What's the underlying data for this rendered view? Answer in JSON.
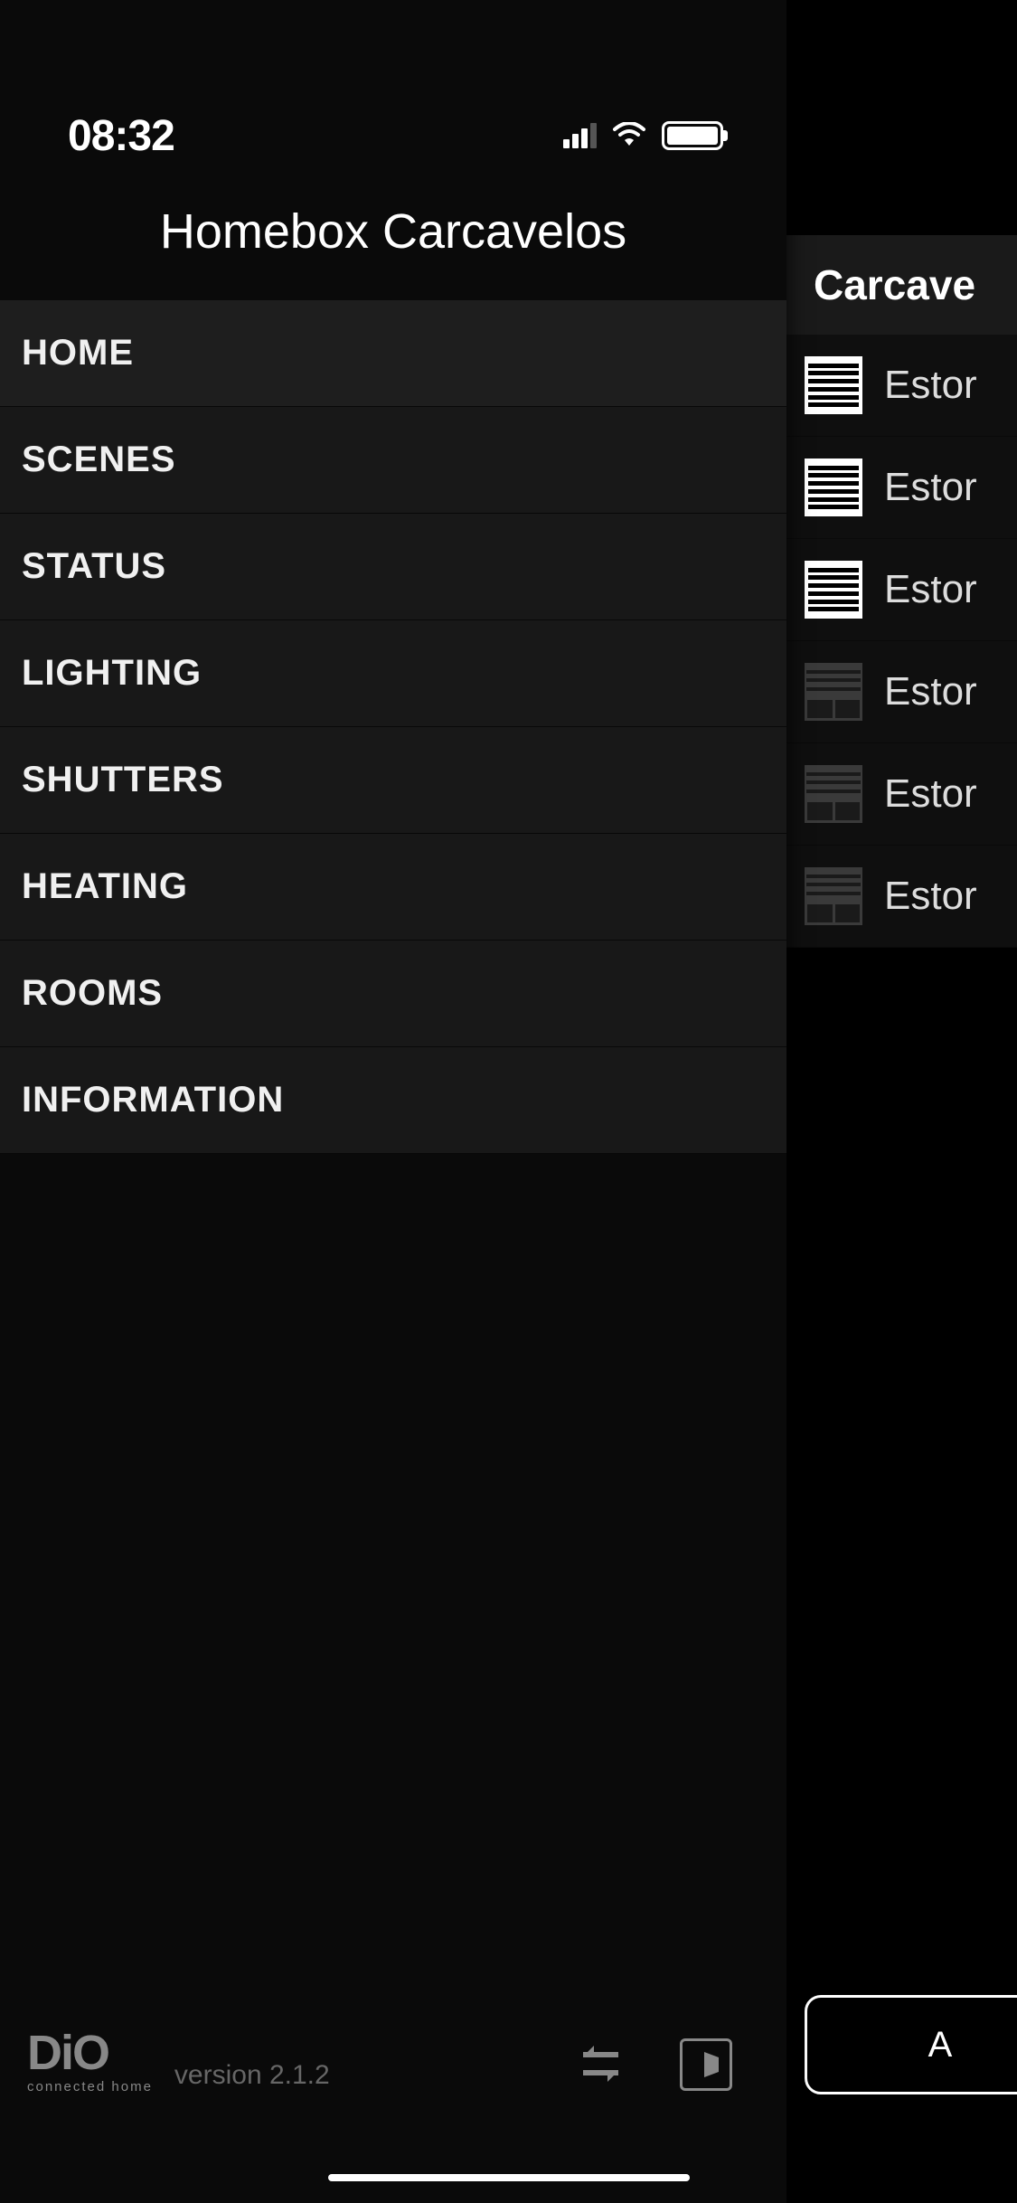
{
  "status_bar": {
    "time": "08:32"
  },
  "sidebar": {
    "title": "Homebox Carcavelos",
    "nav": [
      {
        "label": "HOME",
        "active": true
      },
      {
        "label": "SCENES",
        "active": false
      },
      {
        "label": "STATUS",
        "active": false
      },
      {
        "label": "LIGHTING",
        "active": false
      },
      {
        "label": "SHUTTERS",
        "active": false
      },
      {
        "label": "HEATING",
        "active": false
      },
      {
        "label": "ROOMS",
        "active": false
      },
      {
        "label": "INFORMATION",
        "active": false
      }
    ],
    "footer": {
      "logo": "DiO",
      "logo_subtitle": "connected home",
      "version": "version 2.1.2"
    }
  },
  "main": {
    "section_title": "Carcave",
    "devices": [
      {
        "name": "Estor",
        "state": "open"
      },
      {
        "name": "Estor",
        "state": "open"
      },
      {
        "name": "Estor",
        "state": "open"
      },
      {
        "name": "Estor",
        "state": "closed"
      },
      {
        "name": "Estor",
        "state": "closed"
      },
      {
        "name": "Estor",
        "state": "closed"
      }
    ],
    "bottom_button": "A"
  }
}
